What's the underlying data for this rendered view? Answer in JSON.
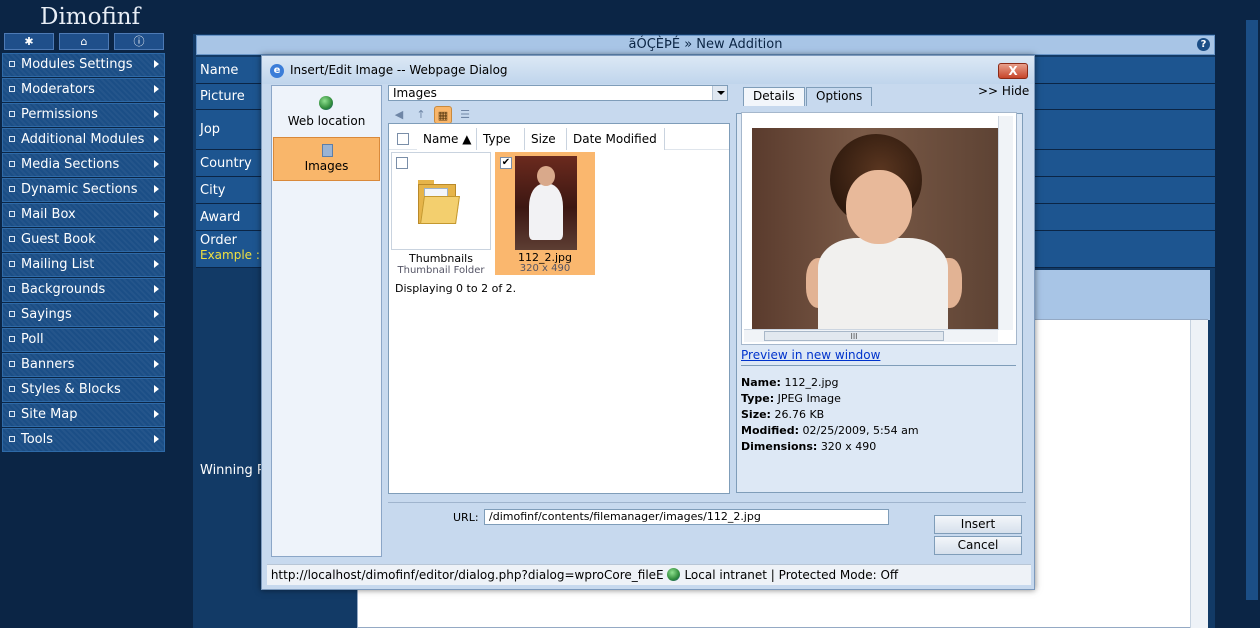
{
  "app": {
    "logo": "Dimofinf",
    "page_header": "ãÓÇÈÞÉ » New Addition",
    "help_icon": "?",
    "top_icons": [
      "settings-icon",
      "home-icon",
      "info-icon"
    ]
  },
  "sidebar": {
    "items": [
      {
        "label": "Modules Settings"
      },
      {
        "label": "Moderators"
      },
      {
        "label": "Permissions"
      },
      {
        "label": "Additional Modules"
      },
      {
        "label": "Media Sections"
      },
      {
        "label": "Dynamic Sections"
      },
      {
        "label": "Mail Box"
      },
      {
        "label": "Guest Book"
      },
      {
        "label": "Mailing List"
      },
      {
        "label": "Backgrounds"
      },
      {
        "label": "Sayings"
      },
      {
        "label": "Poll"
      },
      {
        "label": "Banners"
      },
      {
        "label": "Styles & Blocks"
      },
      {
        "label": "Site Map"
      },
      {
        "label": "Tools"
      }
    ]
  },
  "form": {
    "fields": [
      "Name",
      "Picture",
      "Jop",
      "Country",
      "City",
      "Award",
      "Order",
      "Winning P"
    ],
    "example_label": "Example :"
  },
  "dialog": {
    "title": "Insert/Edit Image -- Webpage Dialog",
    "close_label": "X",
    "sources": [
      {
        "label": "Web location"
      },
      {
        "label": "Images"
      }
    ],
    "folder_select": "Images",
    "columns": [
      "Name ▲",
      "Type",
      "Size",
      "Date Modified"
    ],
    "files": [
      {
        "name": "Thumbnails",
        "sub": "Thumbnail Folder",
        "checked": false
      },
      {
        "name": "112_2.jpg",
        "sub": "320 x 490",
        "checked": true
      }
    ],
    "display_count": "Displaying 0 to 2 of 2.",
    "tabs": [
      "Details",
      "Options"
    ],
    "hide_label": ">> Hide",
    "preview_link": "Preview in new window",
    "scroll_grip": "III",
    "details": [
      {
        "key": "Name:",
        "value": "112_2.jpg"
      },
      {
        "key": "Type:",
        "value": "JPEG Image"
      },
      {
        "key": "Size:",
        "value": "26.76 KB"
      },
      {
        "key": "Modified:",
        "value": "02/25/2009, 5:54 am"
      },
      {
        "key": "Dimensions:",
        "value": "320 x 490"
      }
    ],
    "url_label": "URL:",
    "url_value": "/dimofinf/contents/filemanager/images/112_2.jpg",
    "insert_label": "Insert",
    "cancel_label": "Cancel",
    "status_url": "http://localhost/dimofinf/editor/dialog.php?dialog=wproCore_fileE",
    "status_zone": "Local intranet | Protected Mode: Off"
  }
}
